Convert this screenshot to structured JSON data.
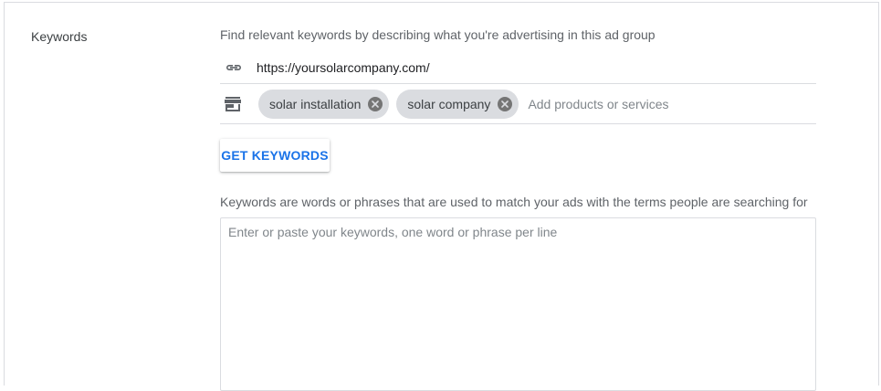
{
  "section": {
    "label": "Keywords"
  },
  "finder": {
    "description": "Find relevant keywords by describing what you're advertising in this ad group",
    "url_icon": "link-icon",
    "url_value": "https://yoursolarcompany.com/",
    "products_icon": "store-icon",
    "chips": [
      {
        "label": "solar installation",
        "remove_icon": "cancel-icon"
      },
      {
        "label": "solar company",
        "remove_icon": "cancel-icon"
      }
    ],
    "add_placeholder": "Add products or services",
    "get_keywords_label": "GET KEYWORDS"
  },
  "keywords": {
    "description": "Keywords are words or phrases that are used to match your ads with the terms people are searching for",
    "placeholder": "Enter or paste your keywords, one word or phrase per line",
    "value": ""
  },
  "colors": {
    "accent": "#1a73e8",
    "chip_bg": "#dadce0",
    "border": "#dadce0",
    "text_secondary": "#5f6368"
  }
}
